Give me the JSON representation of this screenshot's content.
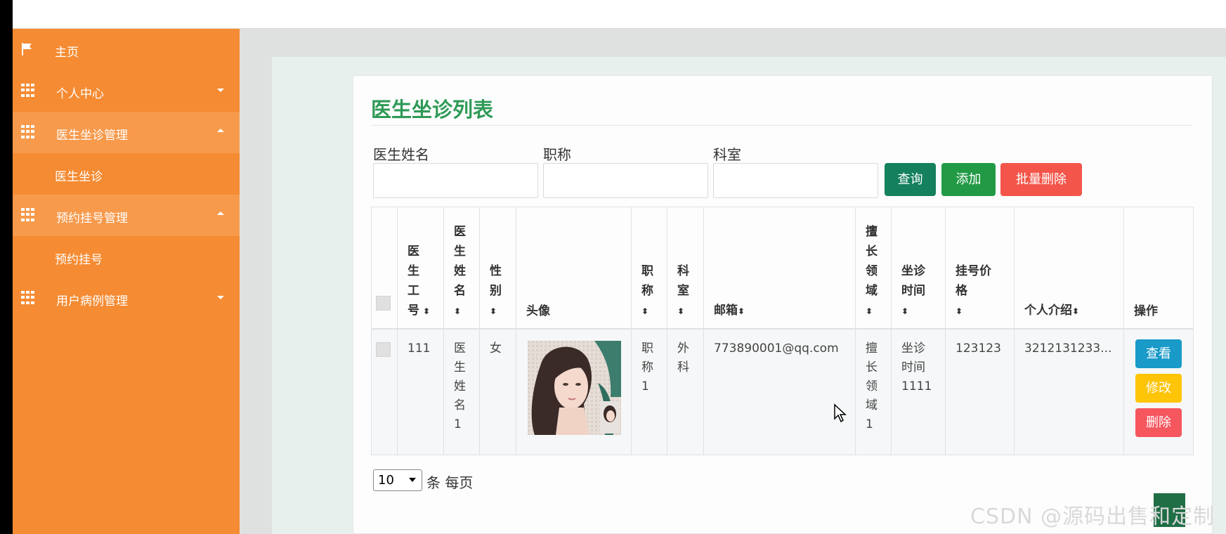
{
  "sidebar": {
    "items": [
      {
        "label": "主页",
        "icon": "flag-icon"
      },
      {
        "label": "个人中心",
        "icon": "grid-icon"
      },
      {
        "label": "医生坐诊管理",
        "icon": "grid-icon"
      },
      {
        "label": "医生坐诊",
        "icon": ""
      },
      {
        "label": "预约挂号管理",
        "icon": "grid-icon"
      },
      {
        "label": "预约挂号",
        "icon": ""
      },
      {
        "label": "用户病例管理",
        "icon": "grid-icon"
      }
    ]
  },
  "page": {
    "title": "医生坐诊列表"
  },
  "filters": {
    "doctor_name_label": "医生姓名",
    "title_label": "职称",
    "dept_label": "科室",
    "doctor_name_value": "",
    "title_value": "",
    "dept_value": ""
  },
  "buttons": {
    "search": "查询",
    "add": "添加",
    "batch_delete": "批量删除"
  },
  "table": {
    "headers": {
      "doctor_id": "医生工号",
      "doctor_name": "医生姓名",
      "gender": "性别",
      "avatar": "头像",
      "title": "职称",
      "dept": "科室",
      "email": "邮箱",
      "specialty": "擅长领域",
      "clinic_time": "坐诊时间",
      "fee": "挂号价格",
      "intro": "个人介绍",
      "ops": "操作"
    },
    "rows": [
      {
        "doctor_id": "111",
        "doctor_name": "医生姓名1",
        "gender": "女",
        "title": "职称1",
        "dept": "外科",
        "email": "773890001@qq.com",
        "specialty": "擅长领域1",
        "clinic_time": "坐诊时间1111",
        "fee": "123123",
        "intro": "3212131233..."
      }
    ],
    "row_buttons": {
      "view": "查看",
      "edit": "修改",
      "delete": "删除"
    }
  },
  "pagination": {
    "page_size": "10",
    "per_page_text": "条 每页"
  },
  "watermark": "CSDN @源码出售和定制",
  "colors": {
    "sidebar": "#f58b32",
    "title": "#2f9a57",
    "search_btn": "#14805e",
    "add_btn": "#229a45",
    "batch_delete_btn": "#f4554a",
    "view_btn": "#199ac8",
    "edit_btn": "#fec408",
    "delete_btn": "#f6565e"
  }
}
